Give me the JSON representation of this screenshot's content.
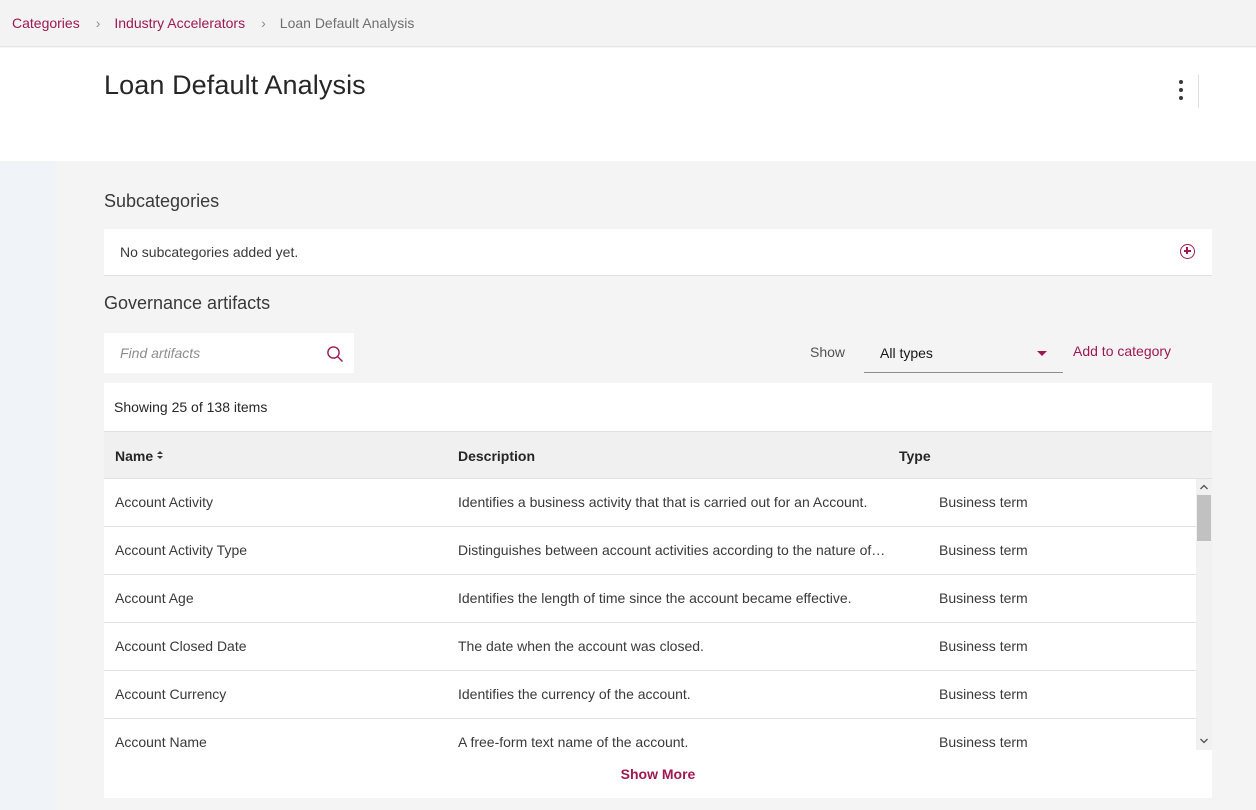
{
  "breadcrumb": {
    "items": [
      "Categories",
      "Industry Accelerators"
    ],
    "current": "Loan Default Analysis",
    "separator": ">"
  },
  "header": {
    "title": "Loan Default Analysis",
    "overflow_icon": "overflow-menu-vertical-icon"
  },
  "subcategories": {
    "title": "Subcategories",
    "empty_text": "No subcategories added yet.",
    "add_icon": "add-circle-icon"
  },
  "governance": {
    "title": "Governance artifacts",
    "search_placeholder": "Find artifacts",
    "search_value": "",
    "show_label": "Show",
    "type_filter": "All types",
    "add_to_category": "Add to category",
    "count_text": "Showing 25 of 138 items",
    "columns": {
      "name": "Name",
      "description": "Description",
      "type": "Type"
    },
    "rows": [
      {
        "name": "Account Activity",
        "description": "Identifies a business activity that that is carried out for an Account.",
        "type": "Business term"
      },
      {
        "name": "Account Activity Type",
        "description": "Distinguishes between account activities according to the nature of…",
        "type": "Business term"
      },
      {
        "name": "Account Age",
        "description": "Identifies the length of time since the account became effective.",
        "type": "Business term"
      },
      {
        "name": "Account Closed Date",
        "description": "The date when the account was closed.",
        "type": "Business term"
      },
      {
        "name": "Account Currency",
        "description": "Identifies the currency of the account.",
        "type": "Business term"
      },
      {
        "name": "Account Name",
        "description": "A free-form text name of the account.",
        "type": "Business term"
      }
    ],
    "show_more": "Show More"
  },
  "colors": {
    "accent": "#9f1853",
    "page_background": "#f4f4f4",
    "surface": "#ffffff",
    "left_rail": "#f0f4f8"
  }
}
